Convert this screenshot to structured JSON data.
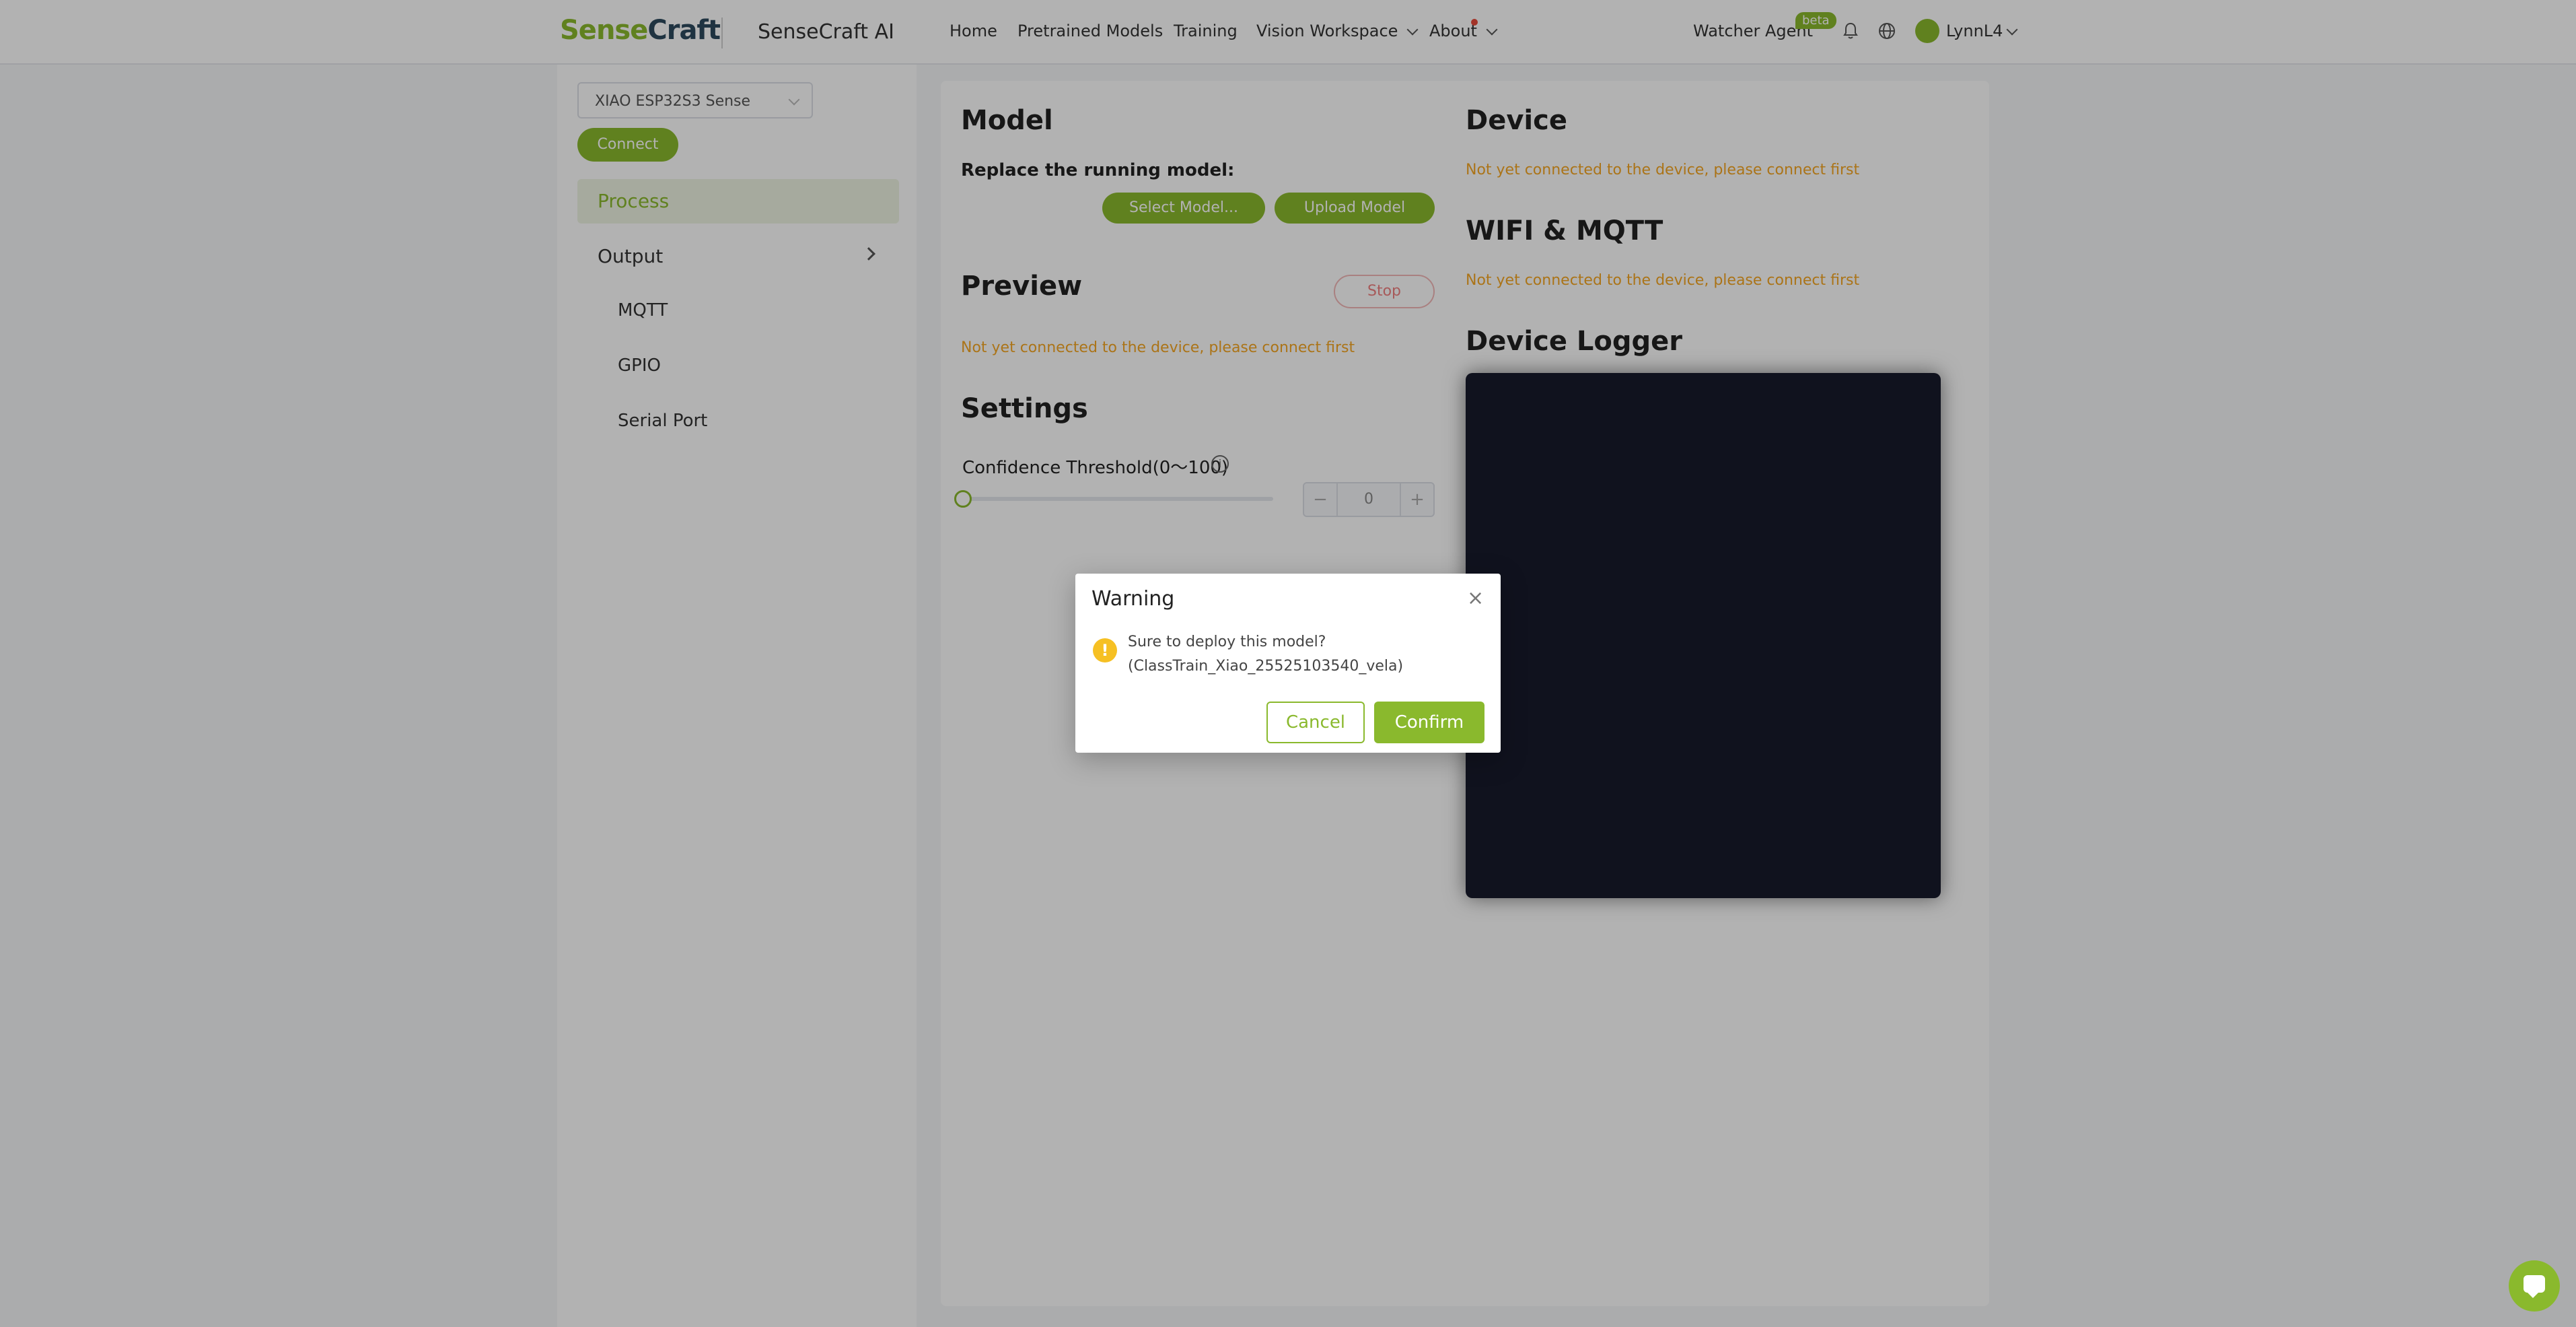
{
  "header": {
    "logo_part1": "Sense",
    "logo_part2": "Craft",
    "brand": "SenseCraft AI",
    "nav": [
      "Home",
      "Pretrained Models",
      "Training",
      "Vision Workspace",
      "About"
    ],
    "watcher_agent": "Watcher Agent",
    "beta_badge": "beta",
    "user_name": "LynnL4"
  },
  "sidebar": {
    "device_select": "XIAO ESP32S3 Sense",
    "connect_label": "Connect",
    "process_label": "Process",
    "output_label": "Output",
    "output_items": [
      "MQTT",
      "GPIO",
      "Serial Port"
    ]
  },
  "main": {
    "model_title": "Model",
    "replace_label": "Replace the running model:",
    "select_model_btn": "Select Model...",
    "upload_model_btn": "Upload Model",
    "preview_title": "Preview",
    "stop_btn": "Stop",
    "preview_warning": "Not yet connected to the device, please connect first",
    "settings_title": "Settings",
    "confidence_label": "Confidence Threshold(0～100)",
    "confidence_value": "0",
    "confidence_minus": "−",
    "confidence_plus": "+",
    "device_title": "Device",
    "device_warning": "Not yet connected to the device, please connect first",
    "wifi_title": "WIFI & MQTT",
    "wifi_warning": "Not yet connected to the device, please connect first",
    "logger_title": "Device Logger"
  },
  "dialog": {
    "title": "Warning",
    "close": "×",
    "warn_glyph": "!",
    "message_line1": "Sure to deploy this model?",
    "message_line2": "(ClassTrain_Xiao_25525103540_vela)",
    "cancel": "Cancel",
    "confirm": "Confirm"
  },
  "colors": {
    "accent": "#8ab92d",
    "warning_text": "#f5a623",
    "logger_bg": "#171a2b"
  }
}
